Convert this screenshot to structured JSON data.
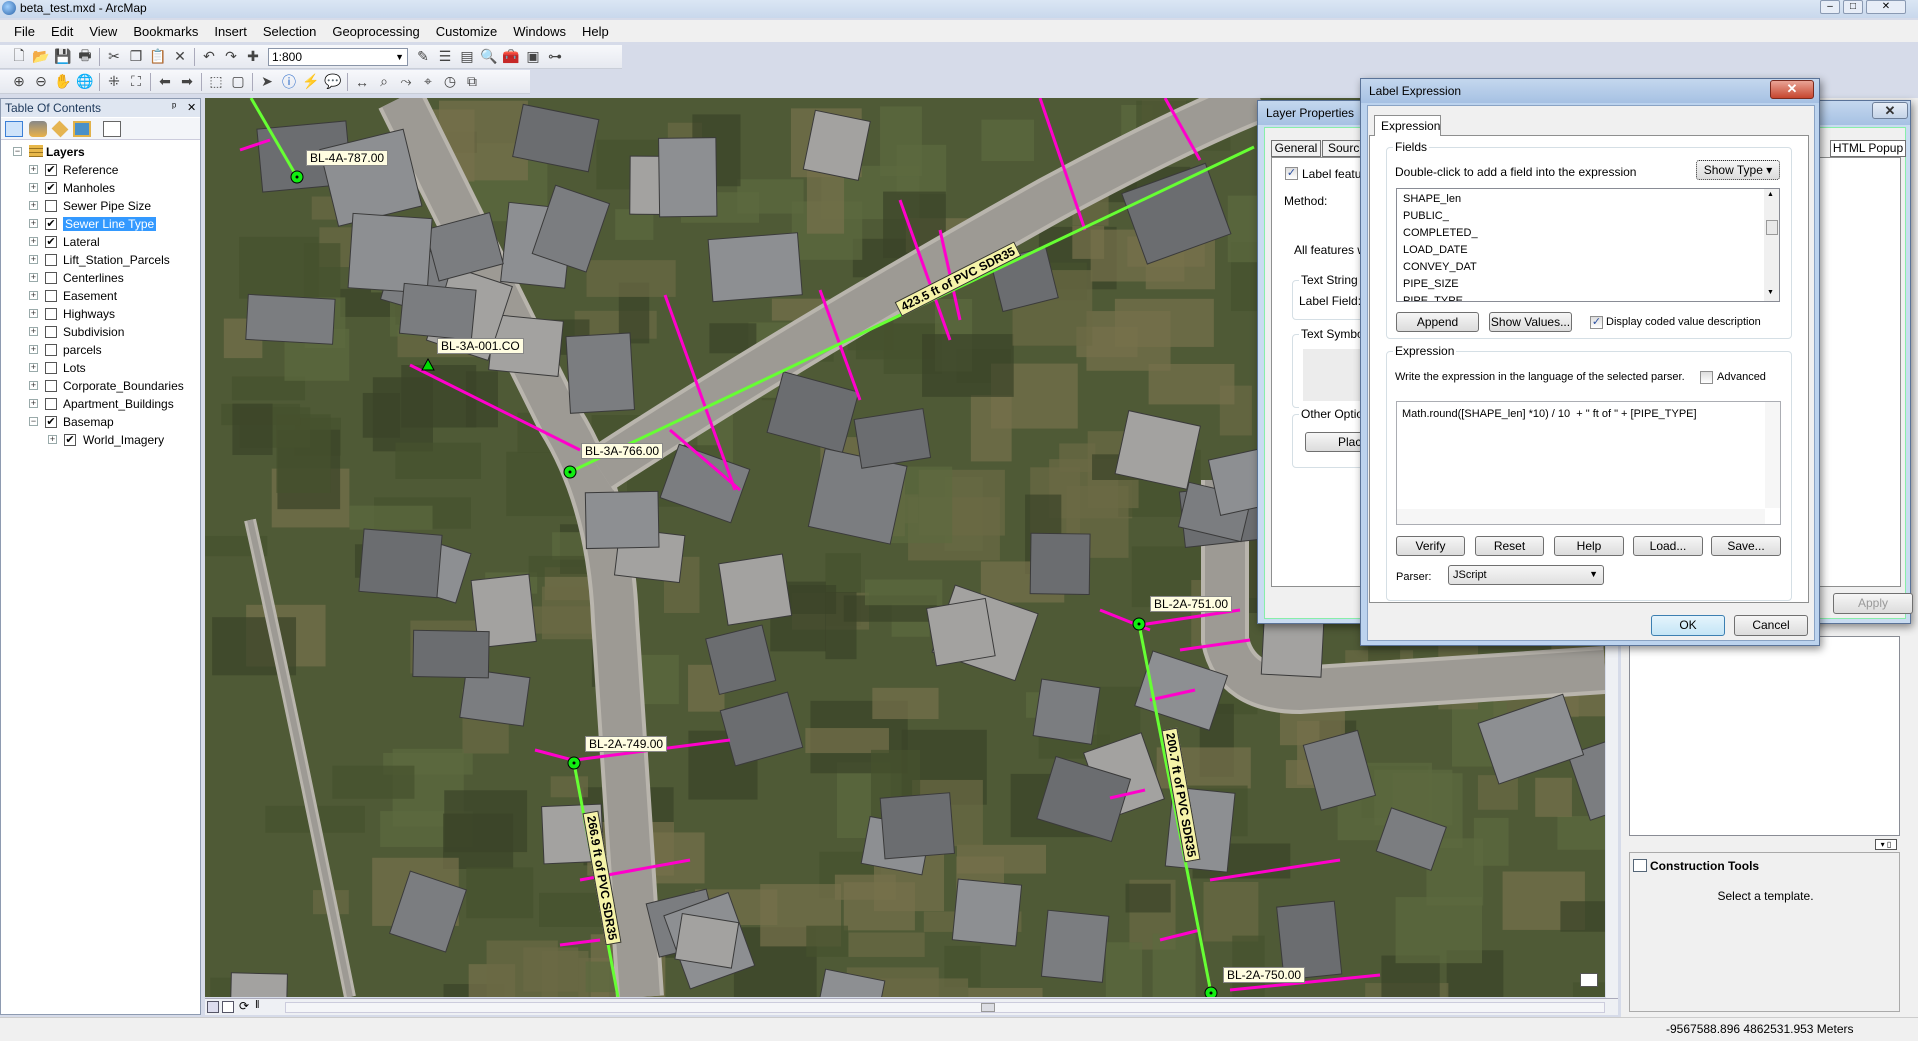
{
  "window": {
    "title": "beta_test.mxd - ArcMap",
    "min": "–",
    "max": "□",
    "close": "✕"
  },
  "menu": [
    "File",
    "Edit",
    "View",
    "Bookmarks",
    "Insert",
    "Selection",
    "Geoprocessing",
    "Customize",
    "Windows",
    "Help"
  ],
  "toolbar1": {
    "icons": [
      "new-document",
      "open-folder",
      "save",
      "print",
      "cut",
      "copy",
      "paste",
      "delete",
      "undo",
      "redo",
      "add-data"
    ],
    "scale": "1:800",
    "icons2": [
      "editor-toolbar",
      "table-of-contents",
      "catalog",
      "search-window",
      "arctoolbox",
      "python",
      "model-builder"
    ]
  },
  "toolbar2": {
    "icons": [
      "zoom-in",
      "zoom-out",
      "pan",
      "full-extent",
      "fixed-zoom-in",
      "fixed-zoom-out",
      "back",
      "forward",
      "select-features",
      "clear-selection",
      "select-elements",
      "identify",
      "hyperlink",
      "html-popup",
      "measure",
      "find",
      "find-route",
      "go-to-xy",
      "time-slider",
      "create-viewer"
    ]
  },
  "toc": {
    "title": "Table Of Contents",
    "pin": "ᵖ",
    "close": "✕",
    "root": "Layers",
    "layers": [
      {
        "name": "Reference",
        "checked": true
      },
      {
        "name": "Manholes",
        "checked": true
      },
      {
        "name": "Sewer Pipe Size",
        "checked": false
      },
      {
        "name": "Sewer Line Type",
        "checked": true,
        "selected": true
      },
      {
        "name": "Lateral",
        "checked": true
      },
      {
        "name": "Lift_Station_Parcels",
        "checked": false
      },
      {
        "name": "Centerlines",
        "checked": false
      },
      {
        "name": "Easement",
        "checked": false
      },
      {
        "name": "Highways",
        "checked": false
      },
      {
        "name": "Subdivision",
        "checked": false
      },
      {
        "name": "parcels",
        "checked": false
      },
      {
        "name": "Lots",
        "checked": false
      },
      {
        "name": "Corporate_Boundaries",
        "checked": false
      },
      {
        "name": "Apartment_Buildings",
        "checked": false
      },
      {
        "name": "Basemap",
        "checked": true,
        "expanded": true
      }
    ],
    "sublayer": {
      "name": "World_Imagery",
      "checked": true
    }
  },
  "map": {
    "manholes": [
      "BL-4A-787.00",
      "BL-3A-001.CO",
      "BL-3A-766.00",
      "BL-2A-751.00",
      "BL-2A-749.00",
      "BL-2A-750.00"
    ],
    "pipes": [
      "423.5 ft of PVC SDR35",
      "200.7 ft of PVC SDR35",
      "266.9 ft of PVC SDR35"
    ],
    "colors": {
      "sewer_line": "#66ff33",
      "lateral": "#ff00cc",
      "label_bg": "#fffde1"
    }
  },
  "layer_props": {
    "title": "Layer Properties",
    "tabs": [
      "General",
      "Source",
      "HTML Popup"
    ],
    "label_features": "Label feature",
    "method": "Method:",
    "all_features": "All features wi",
    "text_string": "Text String",
    "label_field": "Label Field:",
    "text_symbol": "Text Symbol",
    "other_options": "Other Option",
    "placement": "Placer",
    "apply": "Apply",
    "close": "✕"
  },
  "label_expr": {
    "title": "Label Expression",
    "close": "✕",
    "tab": "Expression",
    "fields_group": "Fields",
    "fields_hint": "Double-click to add a field into the expression",
    "show_type": "Show Type",
    "fields": [
      "SHAPE_len",
      "PUBLIC_",
      "COMPLETED_",
      "LOAD_DATE",
      "CONVEY_DAT",
      "PIPE_SIZE",
      "PIPE_TYPE"
    ],
    "append": "Append",
    "show_values": "Show Values...",
    "coded_desc": "Display coded value description",
    "coded_checked": true,
    "expr_group": "Expression",
    "expr_hint": "Write the expression in the language of the selected parser.",
    "advanced": "Advanced",
    "advanced_checked": false,
    "expression": "Math.round([SHAPE_len] *10) / 10  + \" ft of \" + [PIPE_TYPE]",
    "verify": "Verify",
    "reset": "Reset",
    "help": "Help",
    "load": "Load...",
    "save": "Save...",
    "parser_label": "Parser:",
    "parser": "JScript",
    "ok": "OK",
    "cancel": "Cancel"
  },
  "create_features": {
    "construction_tools": "Construction Tools",
    "hint": "Select a template."
  },
  "status": {
    "coords": "-9567588.896  4862531.953 Meters"
  }
}
